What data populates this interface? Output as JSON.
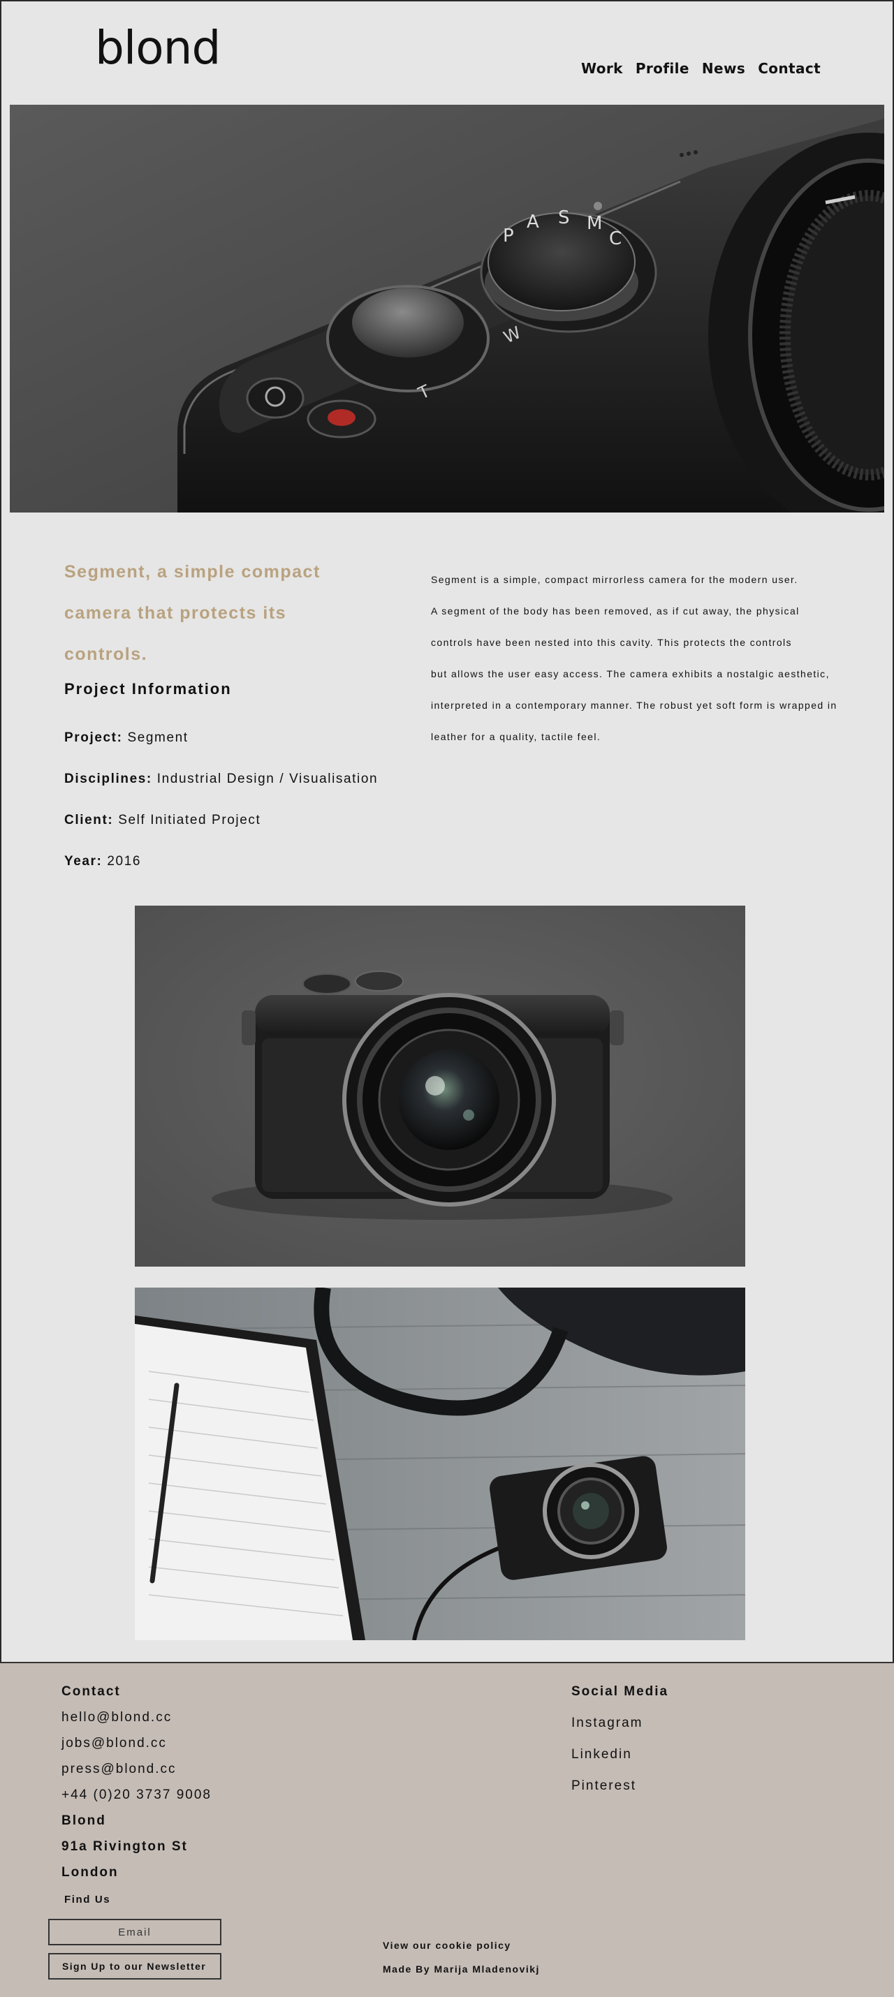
{
  "brand": {
    "logo": "blond"
  },
  "nav": {
    "items": [
      "Work",
      "Profile",
      "News",
      "Contact"
    ]
  },
  "project": {
    "headline_lines": [
      "Segment, a simple compact",
      "camera that protects its",
      "controls."
    ],
    "info_title": "Project Information",
    "meta": [
      {
        "label": "Project:",
        "value": "Segment"
      },
      {
        "label": "Disciplines:",
        "value": "Industrial Design / Visualisation"
      },
      {
        "label": "Client:",
        "value": "Self Initiated Project"
      },
      {
        "label": "Year:",
        "value": "2016"
      }
    ],
    "description_lines": [
      "Segment is a simple, compact mirrorless camera for the modern user.",
      "A segment of the body has been removed, as if cut away, the physical",
      "controls have been nested into this cavity. This protects the controls",
      "but allows the user easy access. The camera exhibits a nostalgic aesthetic,",
      "interpreted in a contemporary manner. The robust yet soft form is wrapped in",
      "leather for a quality, tactile feel."
    ],
    "camera_dial_marks": [
      "P",
      "A",
      "S",
      "M",
      "C"
    ],
    "camera_side_marks": [
      "W",
      "T"
    ]
  },
  "footer": {
    "contact_title": "Contact",
    "contact_lines": [
      "hello@blond.cc",
      "jobs@blond.cc",
      "press@blond.cc",
      "+44 (0)20 3737 9008"
    ],
    "address_lines": [
      "Blond",
      "91a Rivington St",
      "London"
    ],
    "social_title": "Social Media",
    "social_links": [
      "Instagram",
      "Linkedin",
      "Pinterest"
    ],
    "find_us": "Find Us",
    "email_placeholder": "Email",
    "signup_label": "Sign Up to our Newsletter",
    "cookie_label": "View our cookie policy",
    "credit": "Made By Marija Mladenovikj"
  },
  "colors": {
    "page_bg": "#e6e6e6",
    "accent": "#b9a27f",
    "footer_bg": "#c5bcb6",
    "hero_bg": "#4e4e4e"
  }
}
